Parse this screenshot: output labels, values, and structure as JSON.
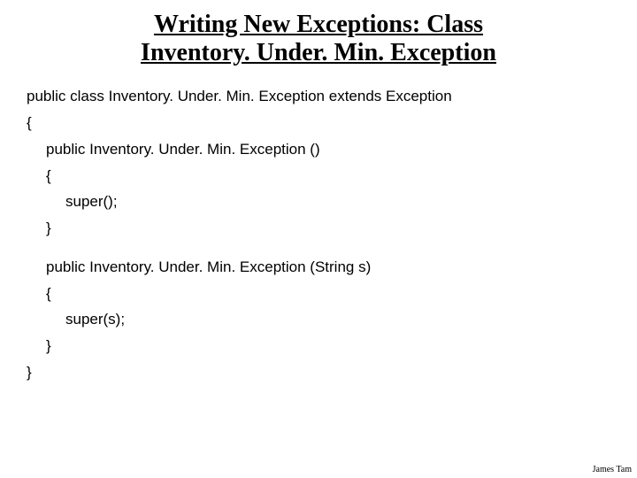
{
  "title_line1": "Writing New Exceptions: Class",
  "title_line2": "Inventory. Under. Min. Exception",
  "code": {
    "l1": "public class Inventory. Under. Min. Exception extends Exception",
    "l2": "{",
    "l3": "public Inventory. Under. Min. Exception ()",
    "l4": "{",
    "l5": "super();",
    "l6": "}",
    "l7": "public Inventory. Under. Min. Exception (String s)",
    "l8": "{",
    "l9": "super(s);",
    "l10": "}",
    "l11": "}"
  },
  "footer": "James Tam"
}
